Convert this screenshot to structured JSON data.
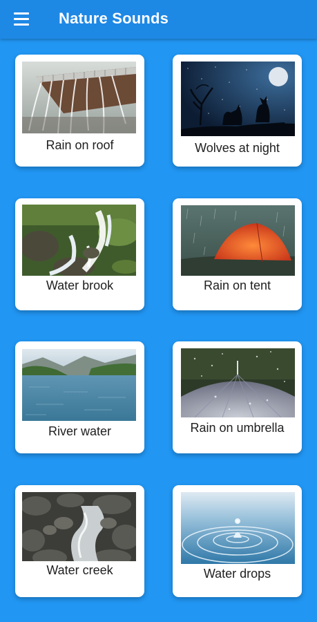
{
  "app": {
    "title": "Nature Sounds",
    "menu_icon": "hamburger-menu-icon",
    "colors": {
      "appbar": "#1E88E5",
      "background": "#2196F3",
      "card": "#FFFFFF"
    }
  },
  "sounds": [
    {
      "label": "Rain on roof"
    },
    {
      "label": "Wolves at night"
    },
    {
      "label": "Water brook"
    },
    {
      "label": "Rain on tent"
    },
    {
      "label": "River water"
    },
    {
      "label": "Rain on umbrella"
    },
    {
      "label": "Water creek"
    },
    {
      "label": "Water drops"
    }
  ]
}
